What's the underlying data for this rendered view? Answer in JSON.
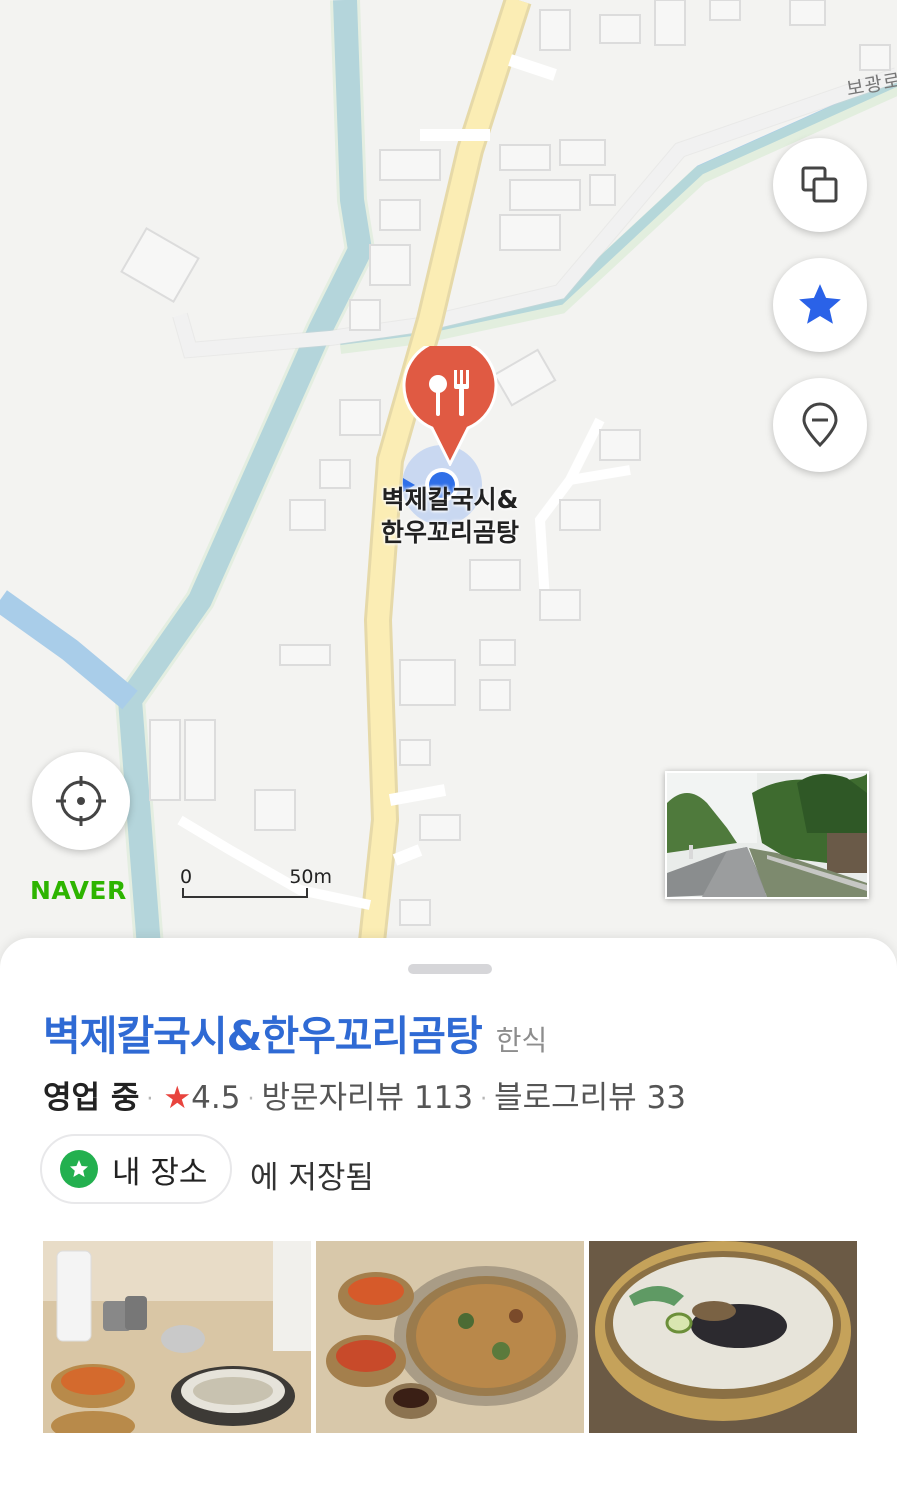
{
  "map": {
    "road_label": "보광로",
    "pin_label_line1": "벽제칼국시&",
    "pin_label_line2": "한우꼬리곰탕",
    "brand_logo": "NAVER",
    "scale_start": "0",
    "scale_distance": "50m",
    "buttons": [
      {
        "name": "layers-icon"
      },
      {
        "name": "star-icon",
        "color": "#2a62e8"
      },
      {
        "name": "location-pin-icon"
      },
      {
        "name": "crosshair-icon"
      }
    ],
    "pin_color": "#e05a43",
    "current_location_color": "#2f6fe8"
  },
  "place": {
    "name": "벽제칼국시&한우꼬리곰탕",
    "category": "한식",
    "status": "영업 중",
    "rating": "4.5",
    "visitor_reviews": "방문자리뷰 113",
    "blog_reviews": "블로그리뷰 33",
    "saved_list": "내 장소",
    "saved_suffix": "에 저장됨"
  },
  "photos": [
    {
      "subject": "restaurant table with soup and kimchi"
    },
    {
      "subject": "pancake with side dishes"
    },
    {
      "subject": "noodle soup in brass bowl"
    }
  ],
  "colors": {
    "title": "#2f6ad4",
    "naver_green": "#2db400",
    "rating_star": "#e8443e",
    "chip_green": "#23b04f"
  }
}
